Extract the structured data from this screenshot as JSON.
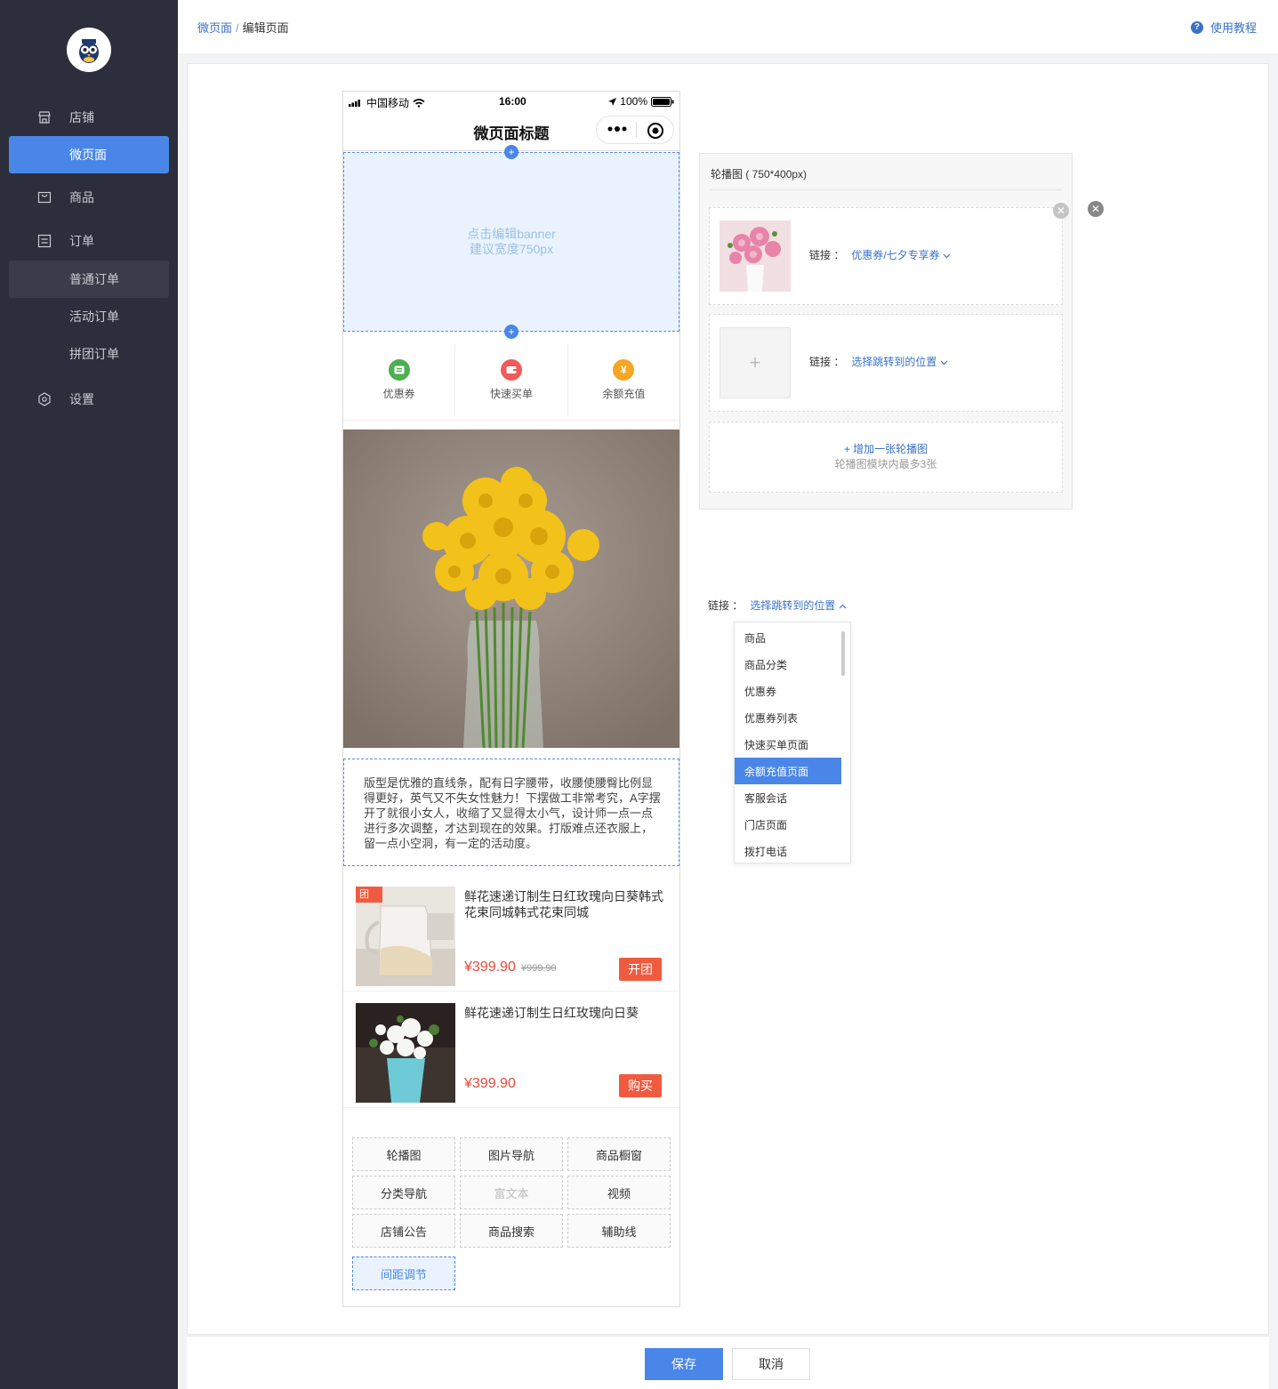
{
  "breadcrumb": {
    "parent": "微页面",
    "separator": "/",
    "current": "编辑页面"
  },
  "help": {
    "label": "使用教程"
  },
  "sidebar": {
    "items": [
      {
        "label": "店铺",
        "icon": "store-icon"
      },
      {
        "label": "微页面",
        "icon": ""
      },
      {
        "label": "商品",
        "icon": "bag-icon"
      },
      {
        "label": "订单",
        "icon": "list-icon"
      },
      {
        "label": "普通订单",
        "icon": ""
      },
      {
        "label": "活动订单",
        "icon": ""
      },
      {
        "label": "拼团订单",
        "icon": ""
      },
      {
        "label": "设置",
        "icon": "gear-icon"
      }
    ]
  },
  "phone": {
    "carrier": "中国移动",
    "time": "16:00",
    "battery": "100%",
    "title": "微页面标题",
    "banner_line1": "点击编辑banner",
    "banner_line2": "建议宽度750px",
    "nav_icons": [
      {
        "label": "优惠券",
        "color": "#4caf50"
      },
      {
        "label": "快速买单",
        "color": "#f05b5b"
      },
      {
        "label": "余额充值",
        "color": "#f5a623"
      }
    ],
    "richtext": "版型是优雅的直线条，配有日字腰带，收腰使腰臀比例显得更好，英气又不失女性魅力！下摆做工非常考究，A字摆开了就很小女人，收缩了又显得太小气，设计师一点一点进行多次调整，才达到现在的效果。打版难点还衣服上，留一点小空洞，有一定的活动度。",
    "products": [
      {
        "tag": "团",
        "name": "鲜花速递订制生日红玫瑰向日葵韩式花束同城韩式花束同城",
        "price": "¥399.90",
        "original_price": "¥999.90",
        "button": "开团"
      },
      {
        "tag": "",
        "name": "鲜花速递订制生日红玫瑰向日葵",
        "price": "¥399.90",
        "original_price": "",
        "button": "购买"
      }
    ],
    "components": [
      "轮播图",
      "图片导航",
      "商品橱窗",
      "分类导航",
      "富文本",
      "视频",
      "店铺公告",
      "商品搜索",
      "辅助线",
      "间距调节"
    ]
  },
  "carousel_panel": {
    "title": "轮播图 ( 750*400px)",
    "link_label": "链接 ：",
    "slot1_link": "优惠券/七夕专享券",
    "slot2_link": "选择跳转到的位置",
    "add_label": "+ 增加一张轮播图",
    "add_hint": "轮播图模块内最多3张"
  },
  "link_dropdown": {
    "label": "链接 ：",
    "value": "选择跳转到的位置",
    "options": [
      "商品",
      "商品分类",
      "优惠券",
      "优惠券列表",
      "快速买单页面",
      "余额充值页面",
      "客服会话",
      "门店页面",
      "拨打电话"
    ],
    "selected": "余额充值页面"
  },
  "footer": {
    "save": "保存",
    "cancel": "取消"
  }
}
